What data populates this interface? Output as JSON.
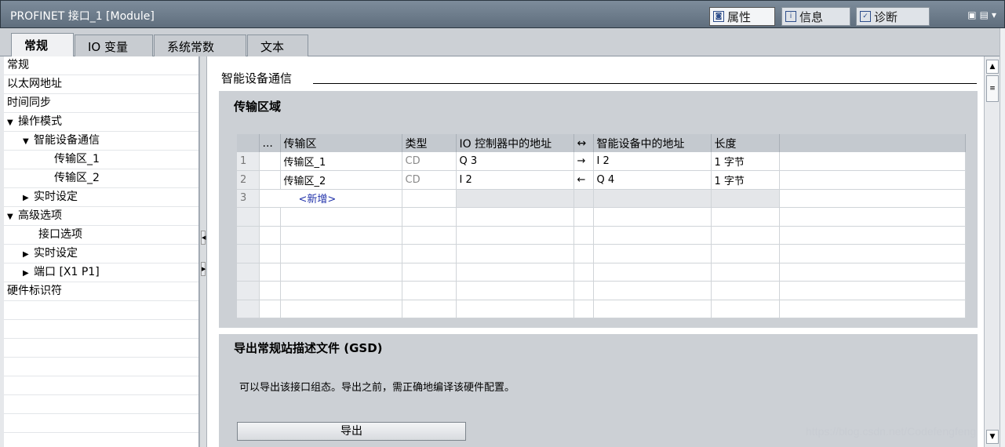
{
  "window": {
    "title": "PROFINET 接口_1 [Module]",
    "inspector_tabs": [
      {
        "label": "属性",
        "icon": "properties-icon",
        "active": true
      },
      {
        "label": "信息",
        "icon": "info-icon",
        "active": false
      },
      {
        "label": "诊断",
        "icon": "diagnostics-icon",
        "active": false
      }
    ]
  },
  "tabs": [
    "常规",
    "IO 变量",
    "系统常数",
    "文本"
  ],
  "nav": {
    "items": [
      {
        "label": "常规",
        "indent": 0,
        "toggle": ""
      },
      {
        "label": "以太网地址",
        "indent": 0,
        "toggle": ""
      },
      {
        "label": "时间同步",
        "indent": 0,
        "toggle": ""
      },
      {
        "label": "操作模式",
        "indent": 0,
        "toggle": "▼"
      },
      {
        "label": "智能设备通信",
        "indent": 1,
        "toggle": "▼",
        "selected": true
      },
      {
        "label": "传输区_1",
        "indent": 3,
        "toggle": ""
      },
      {
        "label": "传输区_2",
        "indent": 3,
        "toggle": ""
      },
      {
        "label": "实时设定",
        "indent": 1,
        "toggle": "▶"
      },
      {
        "label": "高级选项",
        "indent": 0,
        "toggle": "▼"
      },
      {
        "label": "接口选项",
        "indent": 2,
        "toggle": ""
      },
      {
        "label": "实时设定",
        "indent": 1,
        "toggle": "▶"
      },
      {
        "label": "端口 [X1 P1]",
        "indent": 1,
        "toggle": "▶"
      },
      {
        "label": "硬件标识符",
        "indent": 0,
        "toggle": ""
      }
    ]
  },
  "main": {
    "section_title": "智能设备通信",
    "transfer": {
      "title": "传输区域",
      "columns": [
        "",
        "...",
        "传输区",
        "类型",
        "IO 控制器中的地址",
        "↔",
        "智能设备中的地址",
        "长度",
        ""
      ],
      "rows": [
        {
          "num": "1",
          "name": "传输区_1",
          "type": "CD",
          "ctrl_addr": "Q 3",
          "dir": "→",
          "dev_addr": "I 2",
          "length": "1 字节"
        },
        {
          "num": "2",
          "name": "传输区_2",
          "type": "CD",
          "ctrl_addr": "I 2",
          "dir": "←",
          "dev_addr": "Q 4",
          "length": "1 字节"
        }
      ],
      "new_row_num": "3",
      "new_label": "<新增>"
    },
    "export": {
      "title": "导出常规站描述文件 (GSD)",
      "description": "可以导出该接口组态。导出之前，需正确地编译该硬件配置。",
      "button_label": "导出"
    }
  },
  "watermark": "https://blog.csdn.net/Codefengfeng"
}
